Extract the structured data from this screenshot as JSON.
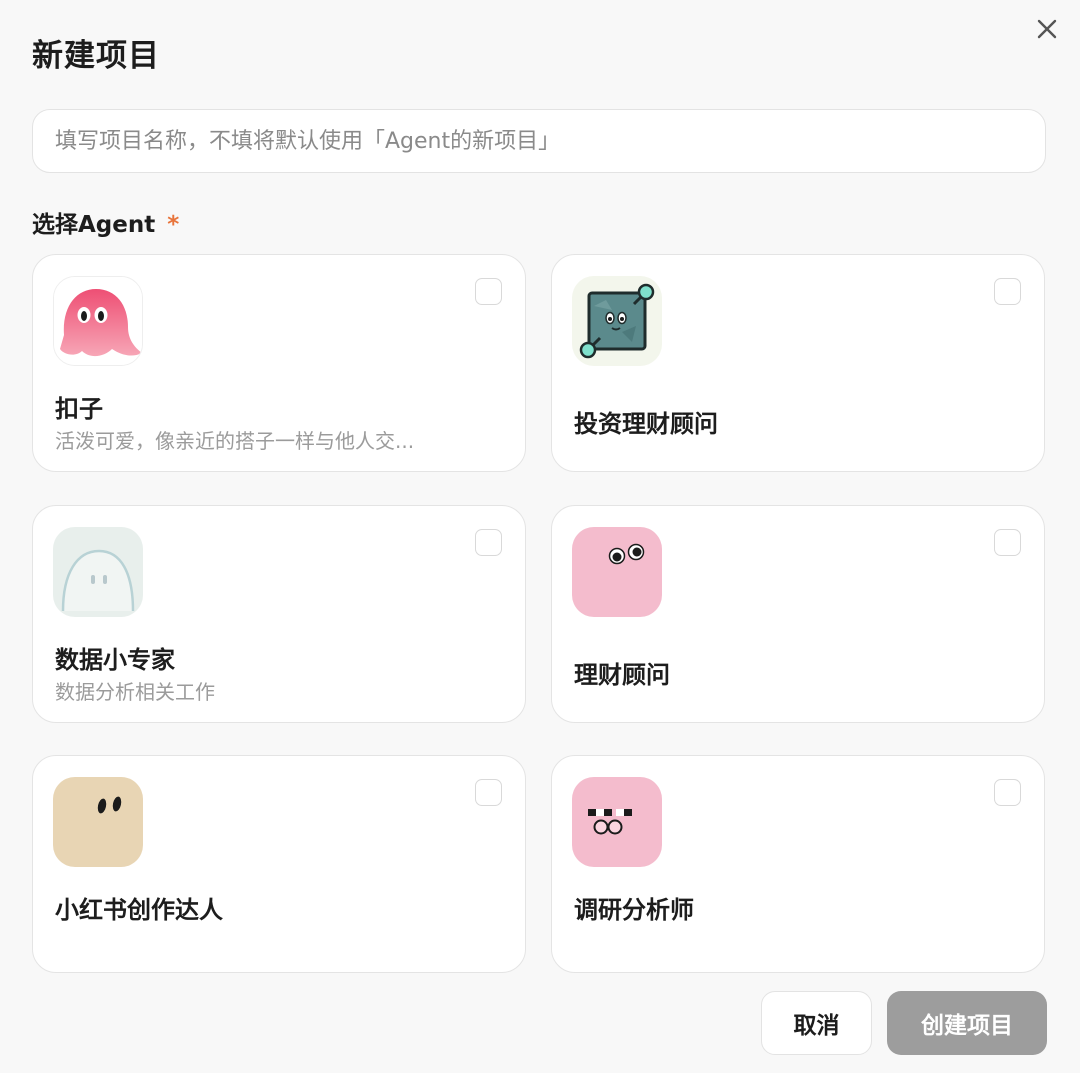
{
  "dialog": {
    "title": "新建项目",
    "close_icon": "close-icon"
  },
  "name_input": {
    "value": "",
    "placeholder": "填写项目名称，不填将默认使用「Agent的新项目」"
  },
  "agent_section": {
    "label": "选择Agent",
    "required_mark": "*",
    "agents": [
      {
        "name": "扣子",
        "description": "活泼可爱，像亲近的搭子一样与他人交...",
        "checked": false,
        "avatar_icon": "pink-ghost-avatar-icon",
        "avatar_color": "#ef5a7a"
      },
      {
        "name": "投资理财顾问",
        "description": "",
        "checked": false,
        "avatar_icon": "teal-square-avatar-icon",
        "avatar_color": "#5b8a8c"
      },
      {
        "name": "数据小专家",
        "description": "数据分析相关工作",
        "checked": false,
        "avatar_icon": "pale-ghost-avatar-icon",
        "avatar_color": "#e8efec"
      },
      {
        "name": "理财顾问",
        "description": "",
        "checked": false,
        "avatar_icon": "pink-blob-avatar-icon",
        "avatar_color": "#f4bccd"
      },
      {
        "name": "小红书创作达人",
        "description": "",
        "checked": false,
        "avatar_icon": "beige-blob-avatar-icon",
        "avatar_color": "#e8d5b4"
      },
      {
        "name": "调研分析师",
        "description": "",
        "checked": false,
        "avatar_icon": "pink-glasses-avatar-icon",
        "avatar_color": "#f4bccd"
      }
    ]
  },
  "footer": {
    "cancel_label": "取消",
    "create_label": "创建项目"
  },
  "colors": {
    "required": "#e8743b",
    "create_disabled": "#9d9d9d",
    "background": "#f8f8f8"
  }
}
